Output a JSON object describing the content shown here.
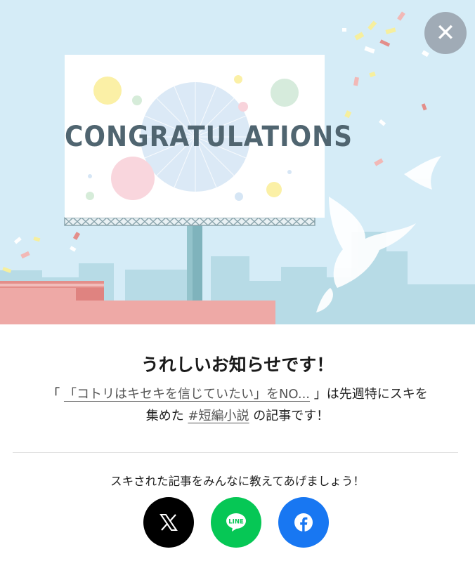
{
  "hero": {
    "billboard_text": "CONGRATULATIONS"
  },
  "close": {
    "glyph": "✕",
    "icon": "close-icon"
  },
  "announcement": {
    "headline": "うれしいお知らせです！",
    "open_quote": "「",
    "article_link": "「コトリはキセキを信じていたい」をNO...",
    "close_quote_text": "」は先週特にスキを",
    "line2_prefix": "集めた ",
    "hashtag_link": "#短編小説",
    "line2_suffix": " の記事です！"
  },
  "share": {
    "prompt": "スキされた記事をみんなに教えてあげましょう！",
    "buttons": [
      {
        "name": "X",
        "icon": "x-logo-icon",
        "color": "#000000"
      },
      {
        "name": "LINE",
        "icon": "line-logo-icon",
        "color": "#06C755",
        "logo_text": "LINE"
      },
      {
        "name": "Facebook",
        "icon": "facebook-logo-icon",
        "color": "#1877F2"
      }
    ]
  },
  "colors": {
    "sky": "#D5ECF7",
    "close_button": "#96A0AA",
    "link": "#555555"
  }
}
